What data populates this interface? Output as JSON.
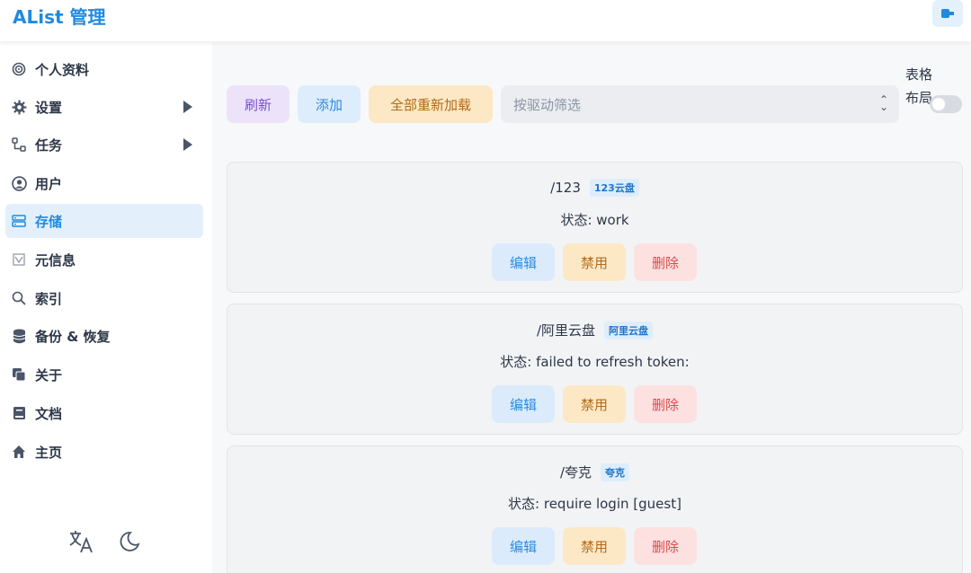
{
  "header": {
    "title": "AList 管理",
    "logout_icon": "logout-icon"
  },
  "sidebar": {
    "items": [
      {
        "label": "个人资料",
        "icon": "fingerprint-icon"
      },
      {
        "label": "设置",
        "icon": "gear-icon",
        "expandable": true
      },
      {
        "label": "任务",
        "icon": "tasks-icon",
        "expandable": true
      },
      {
        "label": "用户",
        "icon": "user-circle-icon"
      },
      {
        "label": "存储",
        "icon": "storage-icon",
        "active": true
      },
      {
        "label": "元信息",
        "icon": "meta-icon"
      },
      {
        "label": "索引",
        "icon": "search-icon"
      },
      {
        "label": "备份 & 恢复",
        "icon": "database-icon"
      },
      {
        "label": "关于",
        "icon": "copy-icon"
      },
      {
        "label": "文档",
        "icon": "book-icon"
      },
      {
        "label": "主页",
        "icon": "home-icon"
      }
    ],
    "bottom": {
      "translate_icon": "translate-icon",
      "theme_icon": "moon-icon"
    }
  },
  "toolbar": {
    "refresh": "刷新",
    "add": "添加",
    "reload_all": "全部重新加载",
    "filter_placeholder": "按驱动筛选",
    "table_layout": "表格布局",
    "table_layout_enabled": false
  },
  "colors": {
    "accent": "#1f8ae0",
    "active_bg": "#e3f0fc"
  },
  "storages": [
    {
      "mount": "/123",
      "driver": "123云盘",
      "status": "状态: work",
      "edit": "编辑",
      "disable": "禁用",
      "delete": "删除"
    },
    {
      "mount": "/阿里云盘",
      "driver": "阿里云盘",
      "status": "状态: failed to refresh token:",
      "edit": "编辑",
      "disable": "禁用",
      "delete": "删除"
    },
    {
      "mount": "/夸克",
      "driver": "夸克",
      "status": "状态: require login [guest]",
      "edit": "编辑",
      "disable": "禁用",
      "delete": "删除"
    }
  ]
}
